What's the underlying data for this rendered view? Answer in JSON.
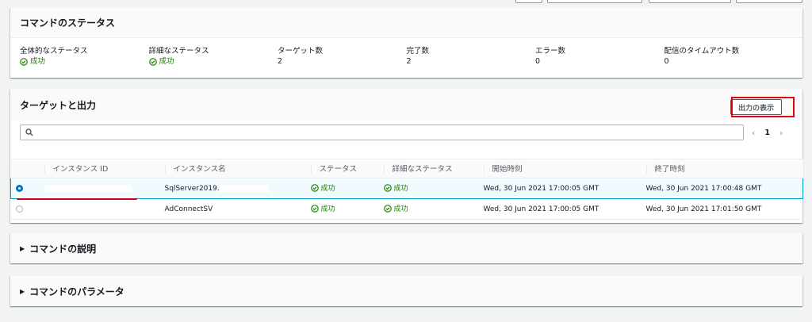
{
  "status_panel": {
    "title": "コマンドのステータス",
    "summary": [
      {
        "label": "全体的なステータス",
        "value": "成功",
        "is_status": true
      },
      {
        "label": "詳細なステータス",
        "value": "成功",
        "is_status": true
      },
      {
        "label": "ターゲット数",
        "value": "2",
        "is_status": false
      },
      {
        "label": "完了数",
        "value": "2",
        "is_status": false
      },
      {
        "label": "エラー数",
        "value": "0",
        "is_status": false
      },
      {
        "label": "配信のタイムアウト数",
        "value": "0",
        "is_status": false
      }
    ]
  },
  "targets_panel": {
    "title": "ターゲットと出力",
    "output_button_label": "出力の表示",
    "search_placeholder": "",
    "pager": {
      "prev": "‹",
      "page": "1",
      "next": "›"
    },
    "columns": [
      "インスタンス ID",
      "インスタンス名",
      "ステータス",
      "詳細なステータス",
      "開始時刻",
      "終了時刻"
    ],
    "rows": [
      {
        "selected": true,
        "instance_id": "",
        "instance_name": "SqlServer2019.",
        "status": "成功",
        "detailed_status": "成功",
        "start": "Wed, 30 Jun 2021 17:00:05 GMT",
        "end": "Wed, 30 Jun 2021 17:00:48 GMT"
      },
      {
        "selected": false,
        "instance_id": "",
        "instance_name": "AdConnectSV",
        "status": "成功",
        "detailed_status": "成功",
        "start": "Wed, 30 Jun 2021 17:00:05 GMT",
        "end": "Wed, 30 Jun 2021 17:01:50 GMT"
      }
    ]
  },
  "description_panel": {
    "title": "コマンドの説明"
  },
  "parameters_panel": {
    "title": "コマンドのパラメータ"
  },
  "colors": {
    "success": "#1d8102",
    "highlight": "#e3010f",
    "selected_border": "#00a1c9",
    "radio_selected": "#0073bb"
  }
}
